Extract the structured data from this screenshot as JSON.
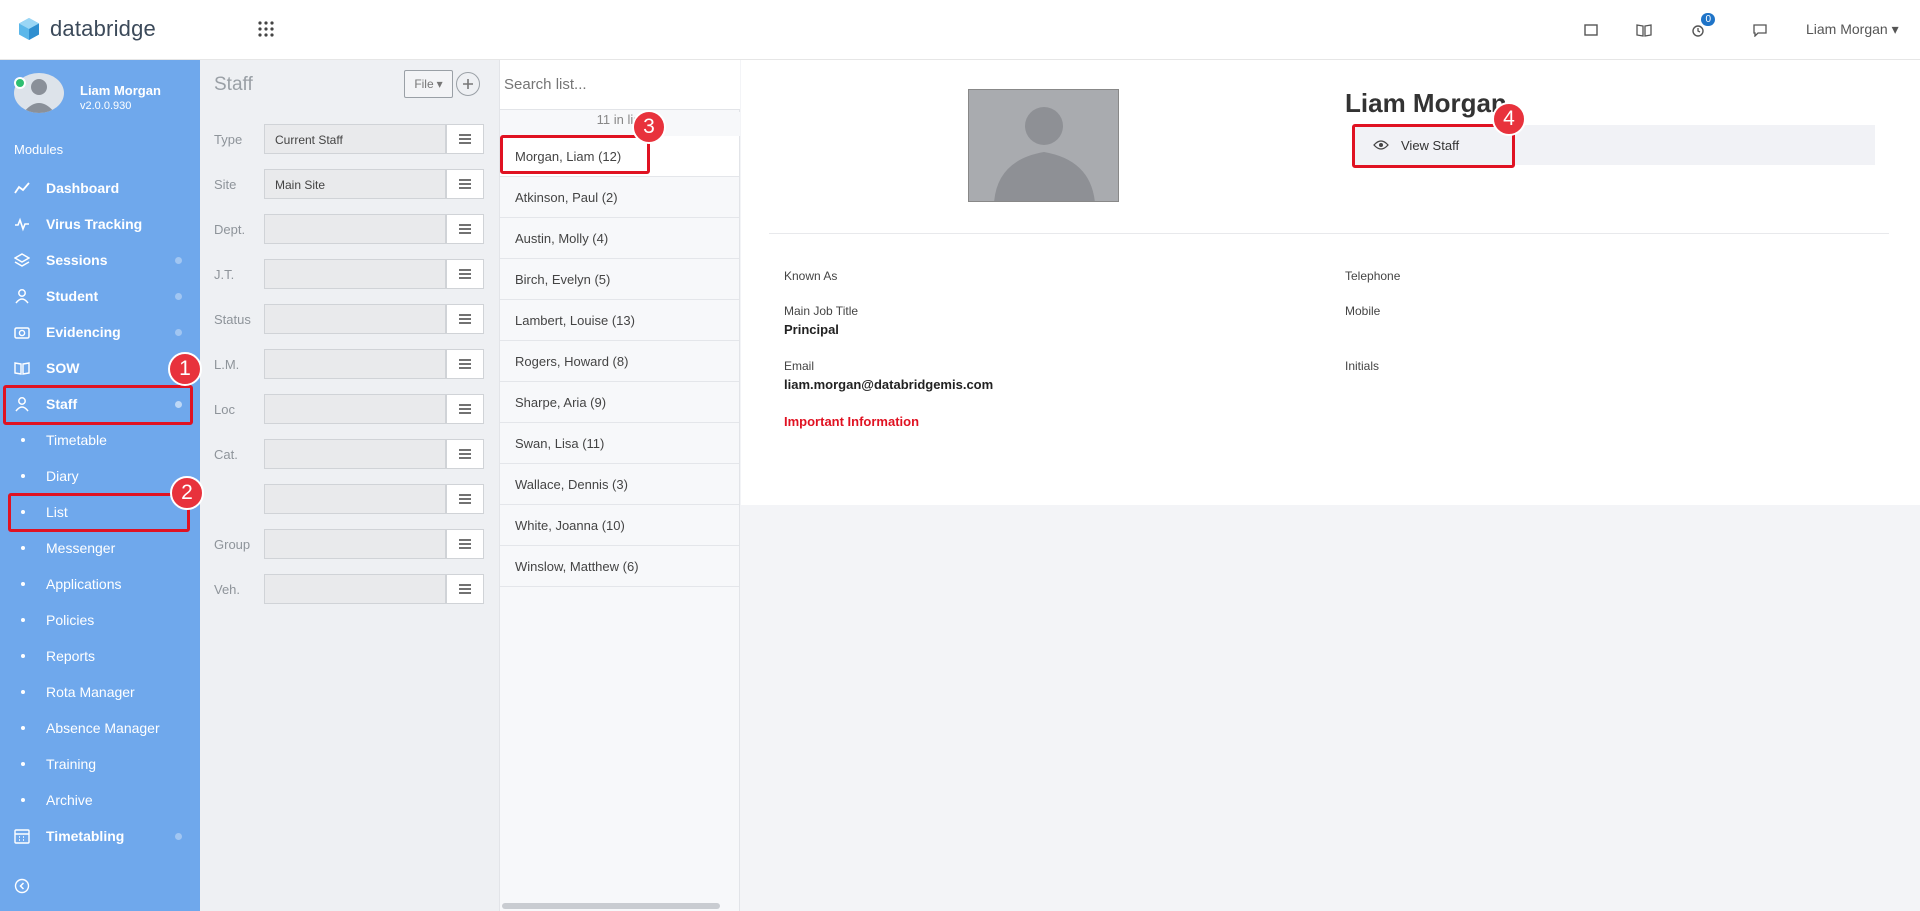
{
  "app": {
    "name": "databridge",
    "user_name": "Liam Morgan",
    "notifications_count": "0"
  },
  "sidebar": {
    "user_name": "Liam Morgan",
    "version": "v2.0.0.930",
    "modules_label": "Modules",
    "items": [
      {
        "label": "Dashboard",
        "icon": "chart-line-icon"
      },
      {
        "label": "Virus Tracking",
        "icon": "pulse-icon"
      },
      {
        "label": "Sessions",
        "icon": "layers-icon"
      },
      {
        "label": "Student",
        "icon": "user-icon"
      },
      {
        "label": "Evidencing",
        "icon": "camera-icon"
      },
      {
        "label": "SOW",
        "icon": "book-icon"
      },
      {
        "label": "Staff",
        "icon": "user-icon"
      }
    ],
    "staff_sub": [
      "Timetable",
      "Diary",
      "List",
      "Messenger",
      "Applications",
      "Policies",
      "Reports",
      "Rota Manager",
      "Absence Manager",
      "Training",
      "Archive"
    ],
    "timetabling_label": "Timetabling"
  },
  "filter": {
    "title": "Staff",
    "file_label": "File",
    "rows": [
      {
        "label": "Type",
        "value": "Current Staff"
      },
      {
        "label": "Site",
        "value": "Main Site"
      },
      {
        "label": "Dept.",
        "value": ""
      },
      {
        "label": "J.T.",
        "value": ""
      },
      {
        "label": "Status",
        "value": ""
      },
      {
        "label": "L.M.",
        "value": ""
      },
      {
        "label": "Loc",
        "value": ""
      },
      {
        "label": "Cat.",
        "value": ""
      },
      {
        "label": "",
        "value": ""
      },
      {
        "label": "Group",
        "value": ""
      },
      {
        "label": "Veh.",
        "value": ""
      }
    ]
  },
  "list": {
    "search_placeholder": "Search list...",
    "count_text": "11 in list",
    "items": [
      "Morgan, Liam (12)",
      "Atkinson, Paul (2)",
      "Austin, Molly (4)",
      "Birch, Evelyn (5)",
      "Lambert, Louise (13)",
      "Rogers, Howard (8)",
      "Sharpe, Aria (9)",
      "Swan, Lisa (11)",
      "Wallace, Dennis (3)",
      "White, Joanna (10)",
      "Winslow, Matthew (6)"
    ]
  },
  "detail": {
    "name": "Liam Morgan",
    "view_label": "View Staff",
    "known_as_label": "Known As",
    "telephone_label": "Telephone",
    "job_title_label": "Main Job Title",
    "job_title_value": "Principal",
    "mobile_label": "Mobile",
    "email_label": "Email",
    "email_value": "liam.morgan@databridgemis.com",
    "initials_label": "Initials",
    "important_label": "Important Information"
  },
  "annotations": [
    "1",
    "2",
    "3",
    "4"
  ],
  "colors": {
    "sidebar": "#6fa8ec",
    "highlight": "#e01222",
    "accent": "#1f74c8"
  }
}
